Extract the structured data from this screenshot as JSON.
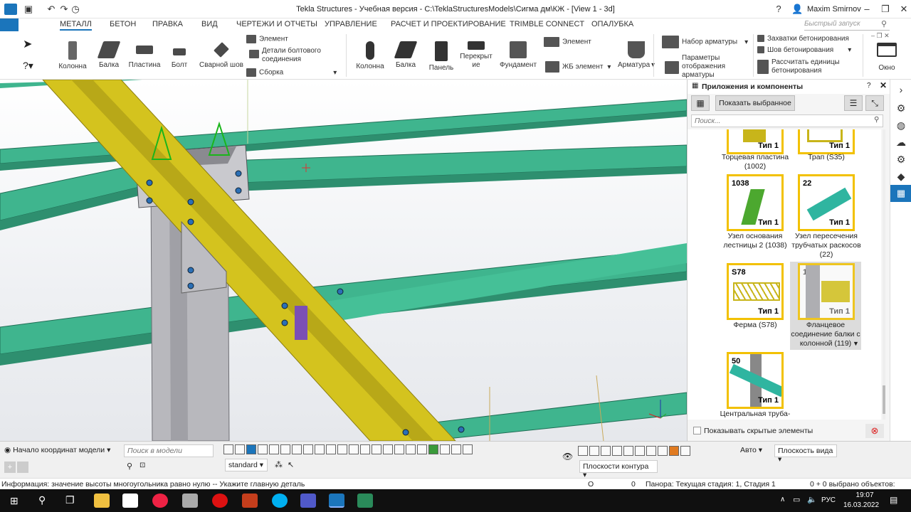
{
  "window": {
    "title": "Tekla Structures - Учебная версия - C:\\TeklaStructuresModels\\Сигма дм\\КЖ  - [View 1 - 3d]",
    "user": "Maxim Smirnov"
  },
  "menu": {
    "tabs": [
      "МЕТАЛЛ",
      "БЕТОН",
      "ПРАВКА",
      "ВИД",
      "ЧЕРТЕЖИ И ОТЧЕТЫ",
      "УПРАВЛЕНИЕ",
      "РАСЧЕТ И ПРОЕКТИРОВАНИЕ",
      "TRIMBLE CONNECT",
      "ОПАЛУБКА"
    ],
    "quick_search": "Быстрый запуск"
  },
  "ribbon": {
    "kolonna": "Колонна",
    "balka": "Балка",
    "plastina": "Пластина",
    "bolt": "Болт",
    "svarnoy": "Сварной шов",
    "element": "Элемент",
    "detali": "Детали болтового соединения",
    "sborka": "Сборка",
    "b_kolonna": "Колонна",
    "b_balka": "Балка",
    "b_panel": "Панель",
    "b_perekryt": "Перекрыт ие",
    "b_fundament": "Фундамент",
    "b_element": "Элемент",
    "zhb_element": "ЖБ элемент",
    "armatura": "Арматура",
    "nabor": "Набор арматуры",
    "parametry": "Параметры отображения арматуры",
    "zahvatki": "Захватки бетонирования",
    "shov": "Шов бетонирования",
    "rasschitat": "Рассчитать единицы бетонирования",
    "okno": "Окно"
  },
  "panel": {
    "title": "Приложения и компоненты",
    "show_selected": "Показать выбранное",
    "search_placeholder": "Поиск...",
    "show_hidden": "Показывать скрытые элементы",
    "items": [
      {
        "num": "",
        "type": "Тип 1",
        "caption": "Торцевая пластина (1002)"
      },
      {
        "num": "",
        "type": "Тип 1",
        "caption": "Трап (S35)"
      },
      {
        "num": "1038",
        "type": "Тип 1",
        "caption": "Узел основания лестницы 2 (1038)"
      },
      {
        "num": "22",
        "type": "Тип 1",
        "caption": "Узел пересечения трубчатых раскосов (22)"
      },
      {
        "num": "S78",
        "type": "Тип 1",
        "caption": "Ферма (S78)"
      },
      {
        "num": "119",
        "type": "Тип 1",
        "caption": "Фланцевое соединение балки с колонной (119)"
      },
      {
        "num": "50",
        "type": "Тип 1",
        "caption": "Центральная труба-"
      }
    ]
  },
  "bottom": {
    "origin": "Начало координат модели",
    "search_model": "Поиск в модели",
    "standard": "standard",
    "auto": "Авто",
    "view_plane": "Плоскость вида",
    "contour_planes": "Плоскости контура"
  },
  "status": {
    "info": "Информация: значение высоты многоугольника равно нулю -- Укажите главную деталь",
    "o": "O",
    "zero": "0",
    "panorama": "Панора: Текущая стадия: 1, Стадия 1",
    "selected": "0 + 0 выбрано объектов:"
  },
  "taskbar": {
    "time": "19:07",
    "date": "16.03.2022",
    "lang": "РУС"
  },
  "colors": {
    "accent": "#1b75bb",
    "beam_green": "#3fb58e",
    "beam_yellow": "#d4c31e",
    "column_gray": "#b8b8bd"
  }
}
